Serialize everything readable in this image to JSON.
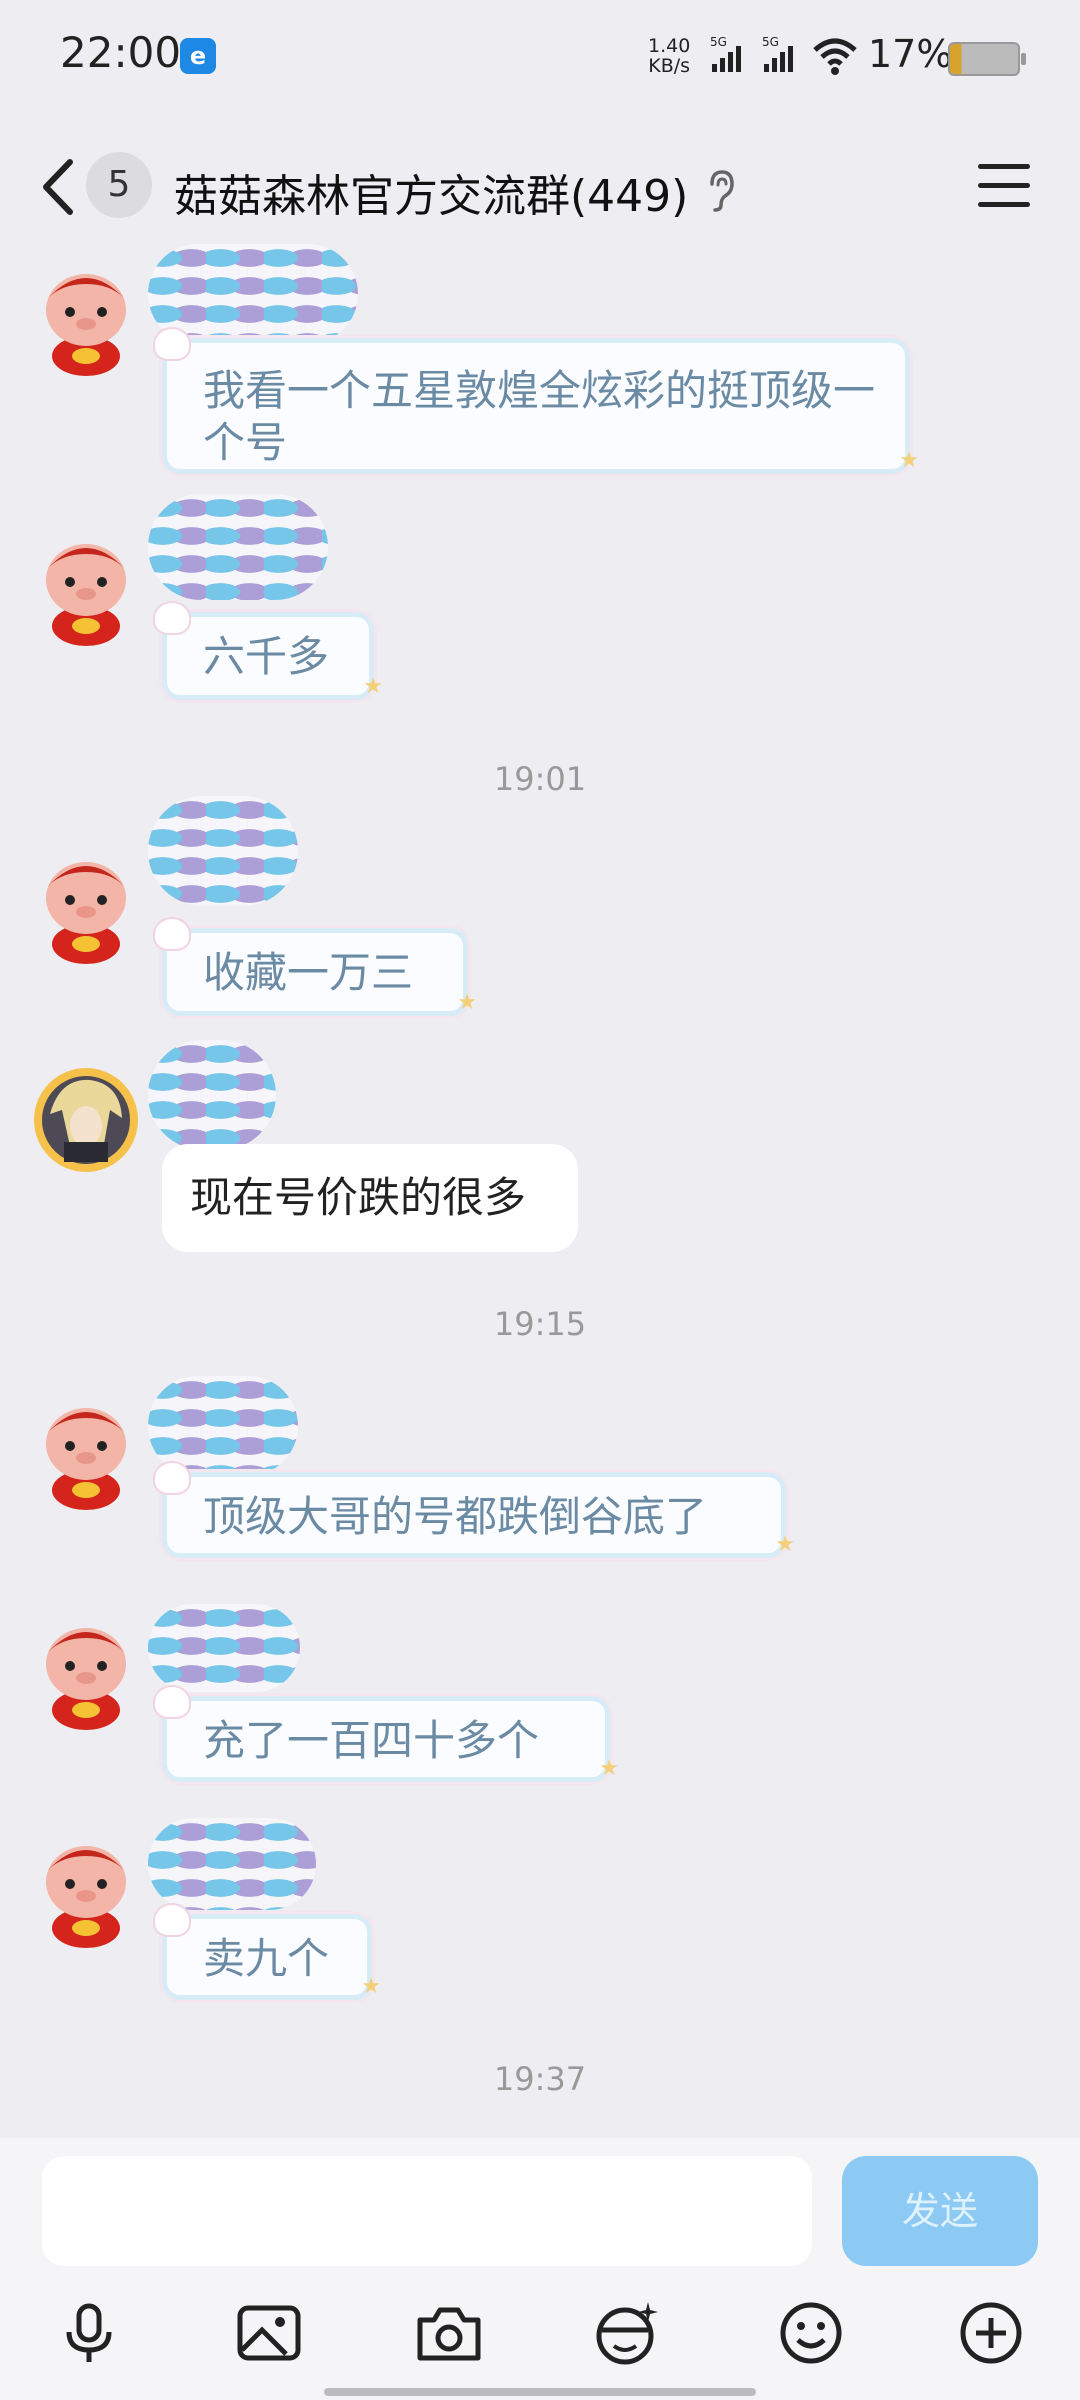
{
  "status_bar": {
    "time": "22:00",
    "net_speed_value": "1.40",
    "net_speed_unit": "KB/s",
    "signal1": "5G",
    "signal2": "5G",
    "battery": "17%"
  },
  "header": {
    "unread_count": "5",
    "title": "菇菇森林官方交流群(449)",
    "back_icon": "chevron-left-icon",
    "ear_icon": "ear-icon",
    "menu_icon": "hamburger-menu-icon"
  },
  "messages": [
    {
      "text": "我看一个五星敦煌全炫彩的挺顶级一个号",
      "style": "decorated"
    },
    {
      "text": "六千多",
      "style": "decorated"
    },
    {
      "text": "收藏一万三",
      "style": "decorated"
    },
    {
      "text": "现在号价跌的很多",
      "style": "plain"
    },
    {
      "text": "顶级大哥的号都跌倒谷底了",
      "style": "decorated"
    },
    {
      "text": "充了一百四十多个",
      "style": "decorated"
    },
    {
      "text": "卖九个",
      "style": "decorated"
    }
  ],
  "timestamps": [
    "19:01",
    "19:15",
    "19:37"
  ],
  "input": {
    "placeholder": "",
    "send_label": "发送"
  },
  "toolbar": [
    "microphone-icon",
    "image-icon",
    "camera-icon",
    "sticker-icon",
    "emoji-icon",
    "plus-icon"
  ],
  "colors": {
    "background": "#eeeef2",
    "send_button": "#8ccaf4",
    "decorated_text": "#6b8aa3"
  }
}
